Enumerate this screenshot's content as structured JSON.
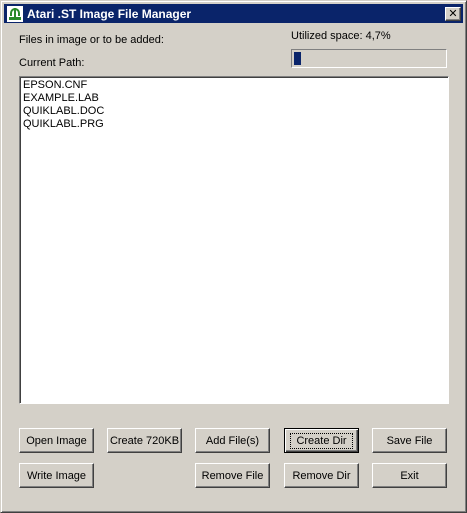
{
  "window": {
    "title": "Atari .ST Image File Manager",
    "close_glyph": "✕"
  },
  "labels": {
    "files_label": "Files in image or to be added:",
    "current_path_label": "Current Path:",
    "utilized_space": "Utilized space: 4,7%"
  },
  "progress": {
    "value_percent": 4.7,
    "fill_color": "#0a246a"
  },
  "files": [
    "EPSON.CNF",
    "EXAMPLE.LAB",
    "QUIKLABL.DOC",
    "QUIKLABL.PRG"
  ],
  "buttons": {
    "open_image": "Open Image",
    "create_720kb": "Create 720KB",
    "add_files": "Add File(s)",
    "create_dir": "Create Dir",
    "save_file": "Save File",
    "write_image": "Write Image",
    "remove_file": "Remove File",
    "remove_dir": "Remove Dir",
    "exit": "Exit"
  },
  "colors": {
    "titlebar": "#0a246a",
    "face": "#d4d0c8"
  },
  "icons": {
    "app": "atari-logo-icon",
    "close": "close-icon"
  }
}
